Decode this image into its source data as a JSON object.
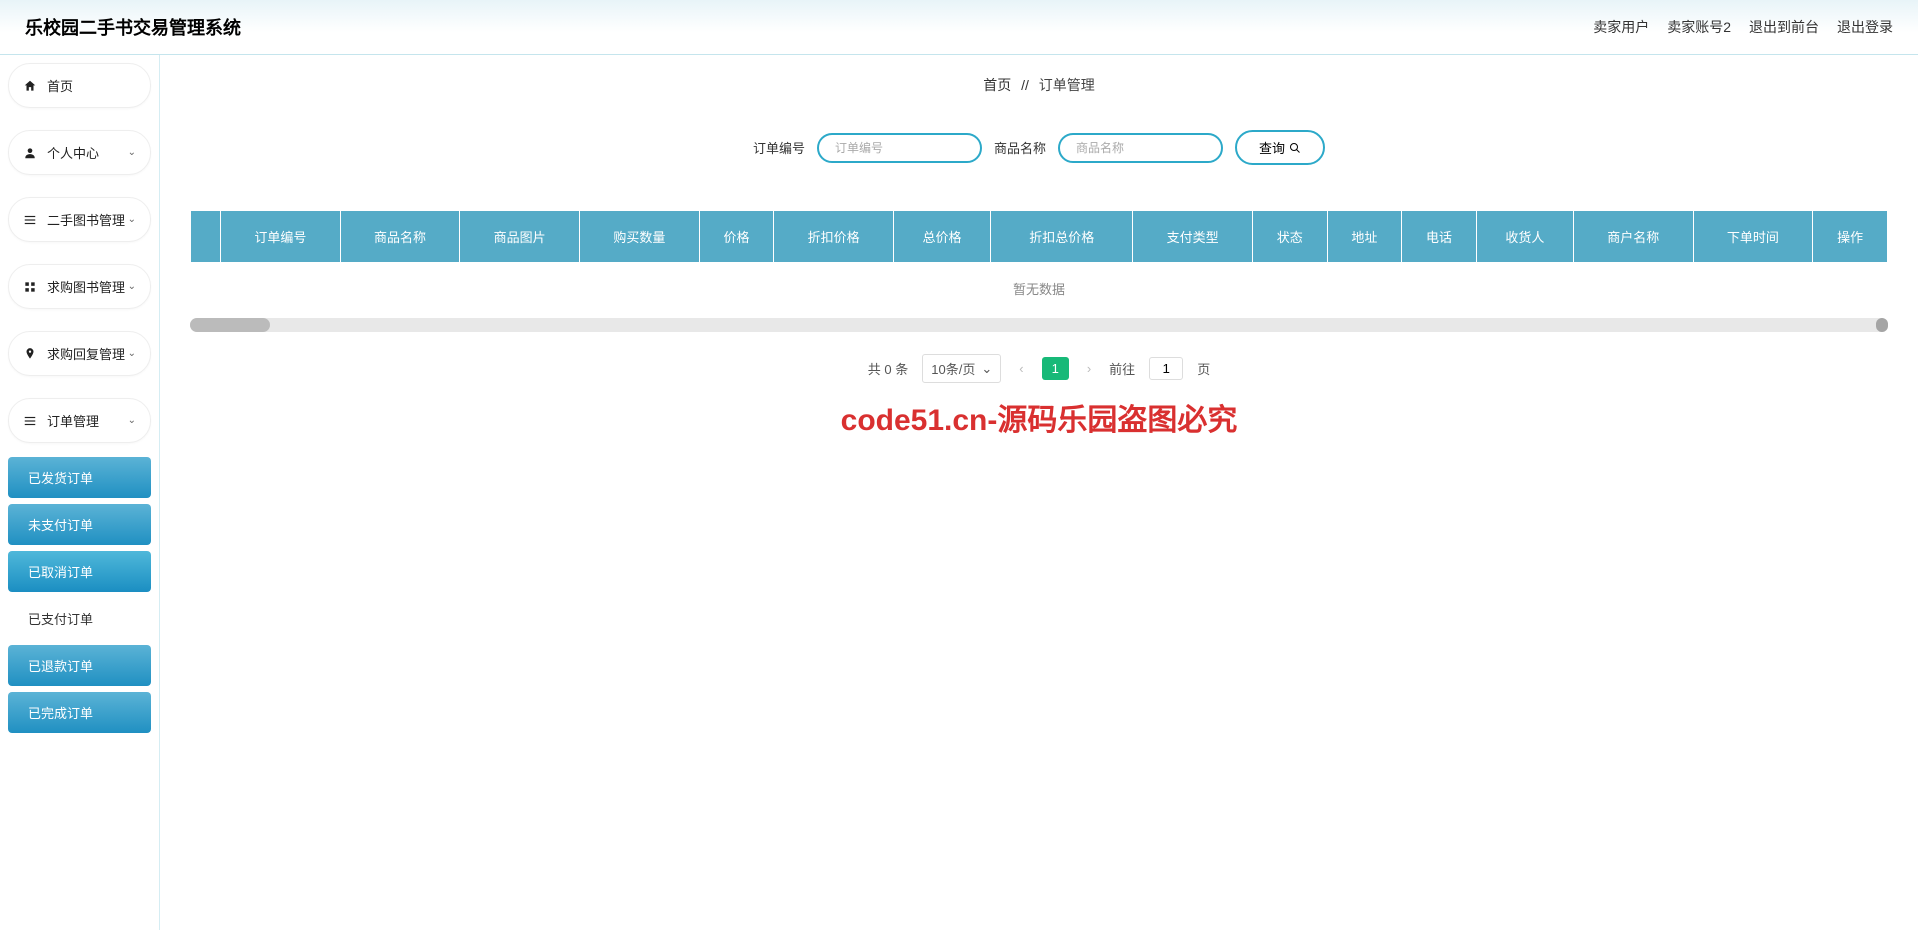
{
  "header": {
    "title": "乐校园二手书交易管理系统",
    "user_label": "卖家用户",
    "user_account": "卖家账号2",
    "exit_front": "退出到前台",
    "logout": "退出登录"
  },
  "sidebar": {
    "items": [
      {
        "icon": "home",
        "label": "首页",
        "chevron": false
      },
      {
        "icon": "user",
        "label": "个人中心",
        "chevron": true
      },
      {
        "icon": "bars",
        "label": "二手图书管理",
        "chevron": true
      },
      {
        "icon": "grid",
        "label": "求购图书管理",
        "chevron": true
      },
      {
        "icon": "pin",
        "label": "求购回复管理",
        "chevron": true
      },
      {
        "icon": "list",
        "label": "订单管理",
        "chevron": true
      }
    ],
    "submenu": [
      {
        "label": "已发货订单",
        "style": "blue"
      },
      {
        "label": "未支付订单",
        "style": "blue"
      },
      {
        "label": "已取消订单",
        "style": "active"
      },
      {
        "label": "已支付订单",
        "style": "white"
      },
      {
        "label": "已退款订单",
        "style": "blue"
      },
      {
        "label": "已完成订单",
        "style": "blue"
      }
    ]
  },
  "breadcrumb": {
    "home": "首页",
    "sep": "//",
    "current": "订单管理"
  },
  "search": {
    "label_order": "订单编号",
    "placeholder_order": "订单编号",
    "label_product": "商品名称",
    "placeholder_product": "商品名称",
    "btn_label": "查询"
  },
  "table": {
    "columns": [
      "",
      "订单编号",
      "商品名称",
      "商品图片",
      "购买数量",
      "价格",
      "折扣价格",
      "总价格",
      "折扣总价格",
      "支付类型",
      "状态",
      "地址",
      "电话",
      "收货人",
      "商户名称",
      "下单时间",
      "操作"
    ],
    "empty": "暂无数据"
  },
  "pagination": {
    "total_label": "共 0 条",
    "per_page": "10条/页",
    "current_page": "1",
    "goto_label": "前往",
    "goto_value": "1",
    "page_suffix": "页"
  },
  "watermark_red": "code51.cn-源码乐园盗图必究"
}
